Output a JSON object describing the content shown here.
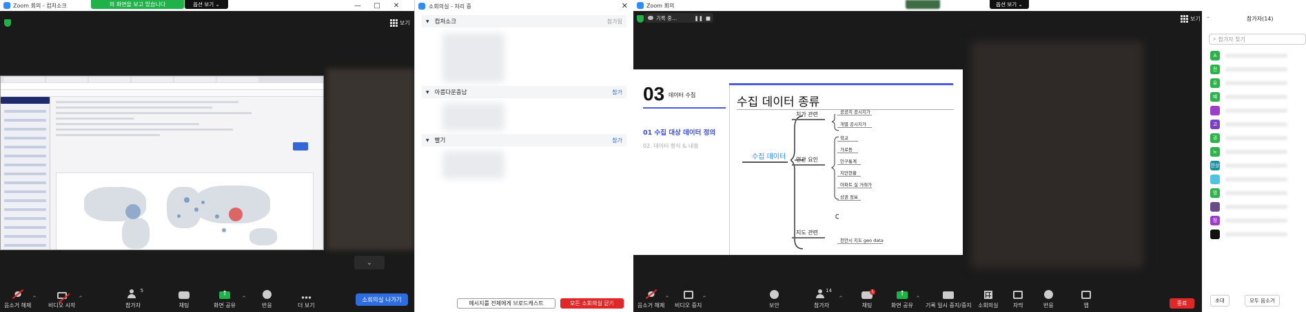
{
  "left_window": {
    "title": "Zoom 회의 - 컴처소크",
    "share_banner": "의 화면을 보고 있습니다",
    "share_options": "옵션 보기 ⌄",
    "view_label": "보기",
    "toolbar": {
      "mute": "음소거 해제",
      "video": "비디오 시작",
      "participants": "참가자",
      "participants_count": "5",
      "chat": "채팅",
      "share": "화면 공유",
      "reactions": "반응",
      "more": "더 보기",
      "leave_breakout": "소회의실 나가기"
    }
  },
  "breakout_dialog": {
    "title": "소회의실 - 처리 중",
    "rooms": [
      {
        "name": "컴처소크",
        "action": "참가됨"
      },
      {
        "name": "아름다운충남",
        "action": "참가"
      },
      {
        "name": "빨기",
        "action": "참가"
      }
    ],
    "broadcast_button": "메시지를 전체에게 브로드캐스트",
    "close_all_button": "모든 소회의실 닫기"
  },
  "right_window": {
    "title": "Zoom 회의",
    "recording_label": "기록 중...",
    "share_options": "옵션 보기 ⌄",
    "view_label": "보기",
    "slide": {
      "number": "03",
      "section": "데이터 수집",
      "heading": "수집 데이터 종류",
      "menu_active": "01 수집 대상 데이터 정의",
      "menu_inactive": "02. 데이터 형식 & 내용",
      "root": "수집 데이터",
      "groups": [
        {
          "label": "치가 관련",
          "items": [
            "공공치 공시지가",
            "개별 공시지가"
          ]
        },
        {
          "label": "연관 요인",
          "items": [
            "학교",
            "가로등",
            "인구통계",
            "치안현황",
            "아파트 실 거래가",
            "상권 정보"
          ]
        },
        {
          "label": "지도 관련",
          "items": [
            "천안시 지도 geo data"
          ]
        }
      ]
    },
    "toolbar": {
      "mute": "음소거 해제",
      "video": "비디오 중지",
      "security": "보안",
      "participants": "참가자",
      "participants_count": "14",
      "chat": "채팅",
      "chat_badge": "1",
      "share": "화면 공유",
      "record": "기록 일시 중지/중지",
      "breakout": "소회의실",
      "caption": "자막",
      "reactions": "반응",
      "apps": "앱",
      "end": "종료"
    },
    "participants_panel": {
      "title": "참가자(14)",
      "search_placeholder": "참가자 찾기",
      "avatars": [
        {
          "initial": "A",
          "color": "#2bb34a"
        },
        {
          "initial": "전",
          "color": "#2bb34a"
        },
        {
          "initial": "유",
          "color": "#2bb34a"
        },
        {
          "initial": "예",
          "color": "#2bb34a"
        },
        {
          "initial": "",
          "color": "#9c3ec8"
        },
        {
          "initial": "고",
          "color": "#7b3fc4"
        },
        {
          "initial": "권",
          "color": "#2bb34a"
        },
        {
          "initial": "노",
          "color": "#2bb34a"
        },
        {
          "initial": "전상",
          "color": "#1a8fa0"
        },
        {
          "initial": "",
          "color": "#4fc3e0"
        },
        {
          "initial": "명",
          "color": "#2bb34a"
        },
        {
          "initial": "",
          "color": "#6b4a8c"
        },
        {
          "initial": "정",
          "color": "#9c3ec8"
        },
        {
          "initial": "",
          "color": "#111111"
        }
      ],
      "invite": "초대",
      "mute_all": "모두 음소거"
    }
  }
}
